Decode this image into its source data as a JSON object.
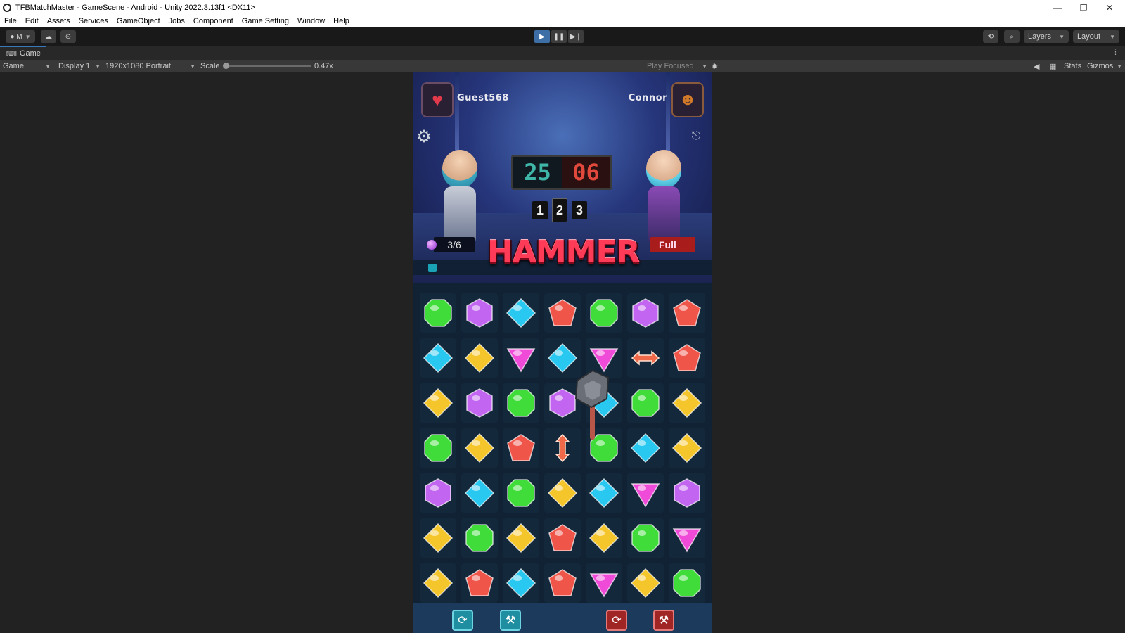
{
  "window": {
    "title": "TFBMatchMaster - GameScene - Android - Unity 2022.3.13f1 <DX11>",
    "controls": [
      "—",
      "❐",
      "✕"
    ]
  },
  "menu": [
    "File",
    "Edit",
    "Assets",
    "Services",
    "GameObject",
    "Jobs",
    "Component",
    "Game Setting",
    "Window",
    "Help"
  ],
  "toolbar": {
    "account_label": "M",
    "layers_label": "Layers",
    "layout_label": "Layout",
    "play_state": "playing"
  },
  "game_tab": {
    "label": "Game"
  },
  "game_bar": {
    "view_select": "Game",
    "display_select": "Display 1",
    "resolution_select": "1920x1080 Portrait",
    "scale_label": "Scale",
    "scale_value": "0.47x",
    "play_mode_select": "Play Focused",
    "stats_label": "Stats",
    "gizmos_label": "Gizmos"
  },
  "game": {
    "player_left": "Guest568",
    "player_right": "Connor",
    "score_left": "25",
    "score_right": "06",
    "rounds": [
      "1",
      "2",
      "3"
    ],
    "current_round": "2",
    "gem_counter": "3/6",
    "full_label": "Full",
    "powerup_title": "HAMMER",
    "board": [
      [
        "green",
        "purple",
        "blue",
        "red",
        "green",
        "purple",
        "red"
      ],
      [
        "blue",
        "yellow",
        "pink",
        "blue",
        "pink",
        "arrow-h",
        "red"
      ],
      [
        "yellow",
        "purple",
        "green",
        "purple",
        "blue",
        "green",
        "yellow"
      ],
      [
        "green",
        "yellow",
        "red",
        "arrow-v",
        "green",
        "blue",
        "yellow"
      ],
      [
        "purple",
        "blue",
        "green",
        "yellow",
        "blue",
        "pink",
        "purple"
      ],
      [
        "yellow",
        "green",
        "yellow",
        "red",
        "yellow",
        "green",
        "pink"
      ],
      [
        "yellow",
        "red",
        "blue",
        "red",
        "pink",
        "yellow",
        "green"
      ]
    ],
    "colors": {
      "green": "#3fdc3a",
      "purple": "#c265f0",
      "blue": "#28c8f0",
      "red": "#f0554a",
      "yellow": "#f5c62b",
      "pink": "#f04ad8",
      "accent_teal": "#3fb6a8",
      "accent_red": "#e2493d"
    }
  }
}
